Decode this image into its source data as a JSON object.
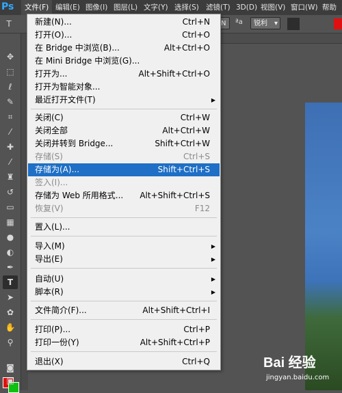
{
  "menubar": {
    "logo": "Ps",
    "items": [
      "文件(F)",
      "编辑(E)",
      "图像(I)",
      "图层(L)",
      "文字(Y)",
      "选择(S)",
      "滤镜(T)",
      "3D(D)",
      "视图(V)",
      "窗口(W)",
      "帮助"
    ]
  },
  "optionsbar": {
    "font_size": "N",
    "aa_label": "ªa",
    "antialias": "锐利"
  },
  "file_menu": {
    "items": [
      {
        "label": "新建(N)...",
        "shortcut": "Ctrl+N"
      },
      {
        "label": "打开(O)...",
        "shortcut": "Ctrl+O"
      },
      {
        "label": "在 Bridge 中浏览(B)...",
        "shortcut": "Alt+Ctrl+O"
      },
      {
        "label": "在 Mini Bridge 中浏览(G)...",
        "shortcut": ""
      },
      {
        "label": "打开为...",
        "shortcut": "Alt+Shift+Ctrl+O"
      },
      {
        "label": "打开为智能对象...",
        "shortcut": ""
      },
      {
        "label": "最近打开文件(T)",
        "shortcut": ""
      },
      {
        "label": "关闭(C)",
        "shortcut": "Ctrl+W"
      },
      {
        "label": "关闭全部",
        "shortcut": "Alt+Ctrl+W"
      },
      {
        "label": "关闭并转到 Bridge...",
        "shortcut": "Shift+Ctrl+W"
      },
      {
        "label": "存储(S)",
        "shortcut": "Ctrl+S"
      },
      {
        "label": "存储为(A)...",
        "shortcut": "Shift+Ctrl+S"
      },
      {
        "label": "签入(I)...",
        "shortcut": ""
      },
      {
        "label": "存储为 Web 所用格式...",
        "shortcut": "Alt+Shift+Ctrl+S"
      },
      {
        "label": "恢复(V)",
        "shortcut": "F12"
      },
      {
        "label": "置入(L)...",
        "shortcut": ""
      },
      {
        "label": "导入(M)",
        "shortcut": ""
      },
      {
        "label": "导出(E)",
        "shortcut": ""
      },
      {
        "label": "自动(U)",
        "shortcut": ""
      },
      {
        "label": "脚本(R)",
        "shortcut": ""
      },
      {
        "label": "文件简介(F)...",
        "shortcut": "Alt+Shift+Ctrl+I"
      },
      {
        "label": "打印(P)...",
        "shortcut": "Ctrl+P"
      },
      {
        "label": "打印一份(Y)",
        "shortcut": "Alt+Shift+Ctrl+P"
      },
      {
        "label": "退出(X)",
        "shortcut": "Ctrl+Q"
      }
    ]
  },
  "watermark": {
    "brand": "Bai 经验",
    "url": "jingyan.baidu.com"
  },
  "colors": {
    "highlight": "#1e6fc5",
    "foreground_swatch": "#e01010",
    "background_swatch": "#10c010"
  }
}
